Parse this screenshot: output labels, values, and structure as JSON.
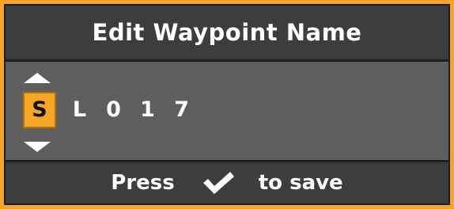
{
  "dialog": {
    "title": "Edit Waypoint Name",
    "name_chars": [
      "S",
      "L",
      "0",
      "1",
      "7"
    ],
    "selected_index": 0
  },
  "footer": {
    "press_label": "Press",
    "save_label": "to save",
    "confirm_icon": "checkmark-icon"
  },
  "colors": {
    "frame": "#f5a623",
    "selected_char_bg": "#f6a623",
    "bar_bg": "#3d3d3d",
    "body_bg": "#5e5e5e"
  }
}
